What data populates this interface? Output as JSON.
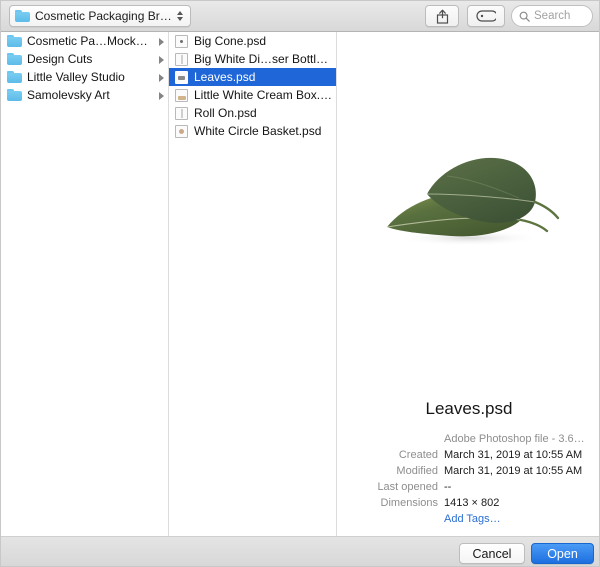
{
  "titlebar": {
    "path_popup_label": "Cosmetic Packaging Br…",
    "share_icon": "share-icon",
    "tag_icon": "tag-icon",
    "search_placeholder": "Search",
    "search_value": "",
    "search_icon": "search-icon"
  },
  "sidebar": {
    "items": [
      {
        "label": "Cosmetic Pa…Mockup Zone",
        "icon": "folder-icon",
        "has_disclosure": true,
        "selected": false
      },
      {
        "label": "Design Cuts",
        "icon": "folder-icon",
        "has_disclosure": true,
        "selected": false
      },
      {
        "label": "Little Valley Studio",
        "icon": "folder-icon",
        "has_disclosure": true,
        "selected": false
      },
      {
        "label": "Samolevsky Art",
        "icon": "folder-icon",
        "has_disclosure": true,
        "selected": false
      }
    ]
  },
  "files": {
    "items": [
      {
        "label": "Big Cone.psd",
        "icon": "psd-thumbnail-icon",
        "selected": false
      },
      {
        "label": "Big White Di…ser Bottle.psd",
        "icon": "psd-thumbnail-icon",
        "selected": false
      },
      {
        "label": "Leaves.psd",
        "icon": "psd-thumbnail-icon",
        "selected": true
      },
      {
        "label": "Little White Cream Box.psd",
        "icon": "psd-thumbnail-icon",
        "selected": false
      },
      {
        "label": "Roll On.psd",
        "icon": "psd-thumbnail-icon",
        "selected": false
      },
      {
        "label": "White Circle Basket.psd",
        "icon": "psd-thumbnail-icon",
        "selected": false
      }
    ]
  },
  "preview": {
    "image_alt": "two green leaves on white background",
    "title": "Leaves.psd",
    "metadata": [
      {
        "label": "",
        "value": "Adobe Photoshop file - 3.6…",
        "style": "muted"
      },
      {
        "label": "Created",
        "value": "March 31, 2019 at 10:55 AM",
        "style": "normal"
      },
      {
        "label": "Modified",
        "value": "March 31, 2019 at 10:55 AM",
        "style": "normal"
      },
      {
        "label": "Last opened",
        "value": "--",
        "style": "normal"
      },
      {
        "label": "Dimensions",
        "value": "1413 × 802",
        "style": "normal"
      },
      {
        "label": "",
        "value": "Add Tags…",
        "style": "link"
      }
    ]
  },
  "bottombar": {
    "cancel_label": "Cancel",
    "open_label": "Open"
  },
  "colors": {
    "selection_blue": "#1f66d8",
    "default_button_blue": "#1d6fe0",
    "link_blue": "#2a6fd4",
    "folder_blue": "#5cbbe8"
  }
}
